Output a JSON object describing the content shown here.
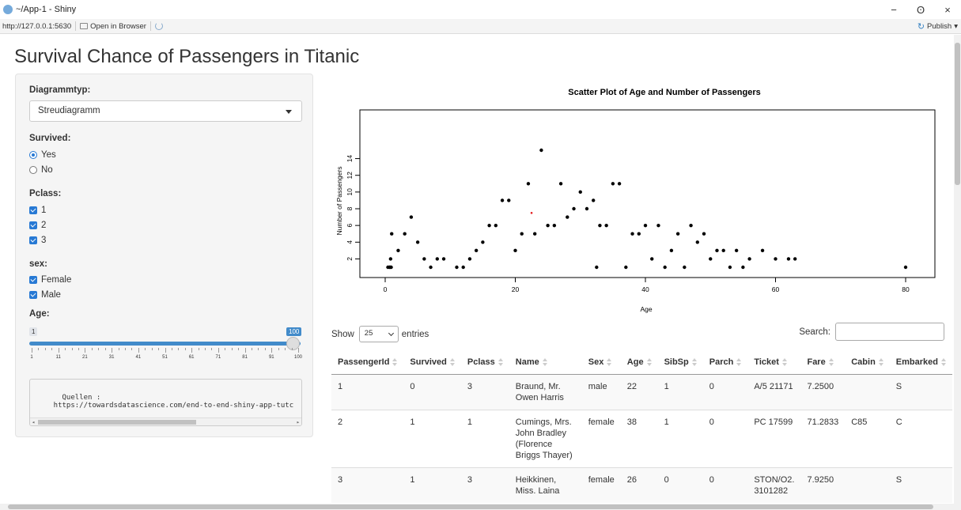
{
  "window": {
    "title": "~/App-1 - Shiny",
    "minimize": "−",
    "maximize": "ʘ",
    "close": "×"
  },
  "toolbar": {
    "url": "http://127.0.0.1:5630",
    "open_browser": "Open in Browser",
    "publish": "Publish",
    "publish_caret": "▾"
  },
  "page": {
    "title": "Survival Chance of Passengers in Titanic"
  },
  "sidebar": {
    "diagram_label": "Diagrammtyp:",
    "diagram_value": "Streudiagramm",
    "survived_label": "Survived:",
    "survived_options": [
      "Yes",
      "No"
    ],
    "pclass_label": "Pclass:",
    "pclass_options": [
      "1",
      "2",
      "3"
    ],
    "sex_label": "sex:",
    "sex_options": [
      "Female",
      "Male"
    ],
    "age_label": "Age:",
    "age_min": "1",
    "age_max": "100",
    "age_ticks": [
      "1",
      "11",
      "21",
      "31",
      "41",
      "51",
      "61",
      "71",
      "81",
      "91",
      "100"
    ],
    "sources_text": "Quellen :\n    https://towardsdatascience.com/end-to-end-shiny-app-tutc"
  },
  "chart_data": {
    "type": "scatter",
    "title": "Scatter Plot of Age and Number of Passengers",
    "xlabel": "Age",
    "ylabel": "Number of Passengers",
    "xlim": [
      0,
      80
    ],
    "ylim": [
      1,
      15
    ],
    "xticks": [
      "0",
      "20",
      "40",
      "60",
      "80"
    ],
    "yticks": [
      "2",
      "4",
      "6",
      "8",
      "10",
      "12",
      "14"
    ],
    "points": [
      [
        0.42,
        1
      ],
      [
        0.67,
        1
      ],
      [
        0.75,
        1
      ],
      [
        0.83,
        2
      ],
      [
        0.92,
        1
      ],
      [
        1,
        5
      ],
      [
        2,
        3
      ],
      [
        3,
        5
      ],
      [
        4,
        7
      ],
      [
        5,
        4
      ],
      [
        6,
        2
      ],
      [
        7,
        1
      ],
      [
        8,
        2
      ],
      [
        9,
        2
      ],
      [
        11,
        1
      ],
      [
        12,
        1
      ],
      [
        13,
        2
      ],
      [
        14,
        3
      ],
      [
        15,
        4
      ],
      [
        16,
        6
      ],
      [
        17,
        6
      ],
      [
        18,
        9
      ],
      [
        19,
        9
      ],
      [
        20,
        3
      ],
      [
        21,
        5
      ],
      [
        22,
        11
      ],
      [
        23,
        5
      ],
      [
        24,
        15
      ],
      [
        25,
        6
      ],
      [
        26,
        6
      ],
      [
        27,
        11
      ],
      [
        28,
        7
      ],
      [
        29,
        8
      ],
      [
        30,
        10
      ],
      [
        31,
        8
      ],
      [
        32,
        9
      ],
      [
        33,
        6
      ],
      [
        34,
        6
      ],
      [
        35,
        11
      ],
      [
        36,
        11
      ],
      [
        37,
        1
      ],
      [
        38,
        5
      ],
      [
        39,
        5
      ],
      [
        40,
        6
      ],
      [
        41,
        2
      ],
      [
        42,
        6
      ],
      [
        43,
        1
      ],
      [
        44,
        3
      ],
      [
        45,
        5
      ],
      [
        46,
        1
      ],
      [
        47,
        6
      ],
      [
        48,
        4
      ],
      [
        49,
        5
      ],
      [
        50,
        2
      ],
      [
        51,
        3
      ],
      [
        52,
        3
      ],
      [
        53,
        1
      ],
      [
        54,
        3
      ],
      [
        55,
        1
      ],
      [
        56,
        2
      ],
      [
        58,
        3
      ],
      [
        60,
        2
      ],
      [
        62,
        2
      ],
      [
        63,
        2
      ],
      [
        80,
        1
      ],
      [
        32.5,
        1
      ]
    ],
    "highlight": [
      22.5,
      7.5
    ],
    "highlight_color": "#e41a1c",
    "point_color": "#000000"
  },
  "table": {
    "show_label": "Show",
    "page_length": "25",
    "entries_label": "entries",
    "search_label": "Search:",
    "columns": [
      "PassengerId",
      "Survived",
      "Pclass",
      "Name",
      "Sex",
      "Age",
      "SibSp",
      "Parch",
      "Ticket",
      "Fare",
      "Cabin",
      "Embarked"
    ],
    "rows": [
      [
        "1",
        "0",
        "3",
        "Braund, Mr. Owen Harris",
        "male",
        "22",
        "1",
        "0",
        "A/5 21171",
        "7.2500",
        "",
        "S"
      ],
      [
        "2",
        "1",
        "1",
        "Cumings, Mrs. John Bradley (Florence Briggs Thayer)",
        "female",
        "38",
        "1",
        "0",
        "PC 17599",
        "71.2833",
        "C85",
        "C"
      ],
      [
        "3",
        "1",
        "3",
        "Heikkinen, Miss. Laina",
        "female",
        "26",
        "0",
        "0",
        "STON/O2. 3101282",
        "7.9250",
        "",
        "S"
      ]
    ]
  }
}
